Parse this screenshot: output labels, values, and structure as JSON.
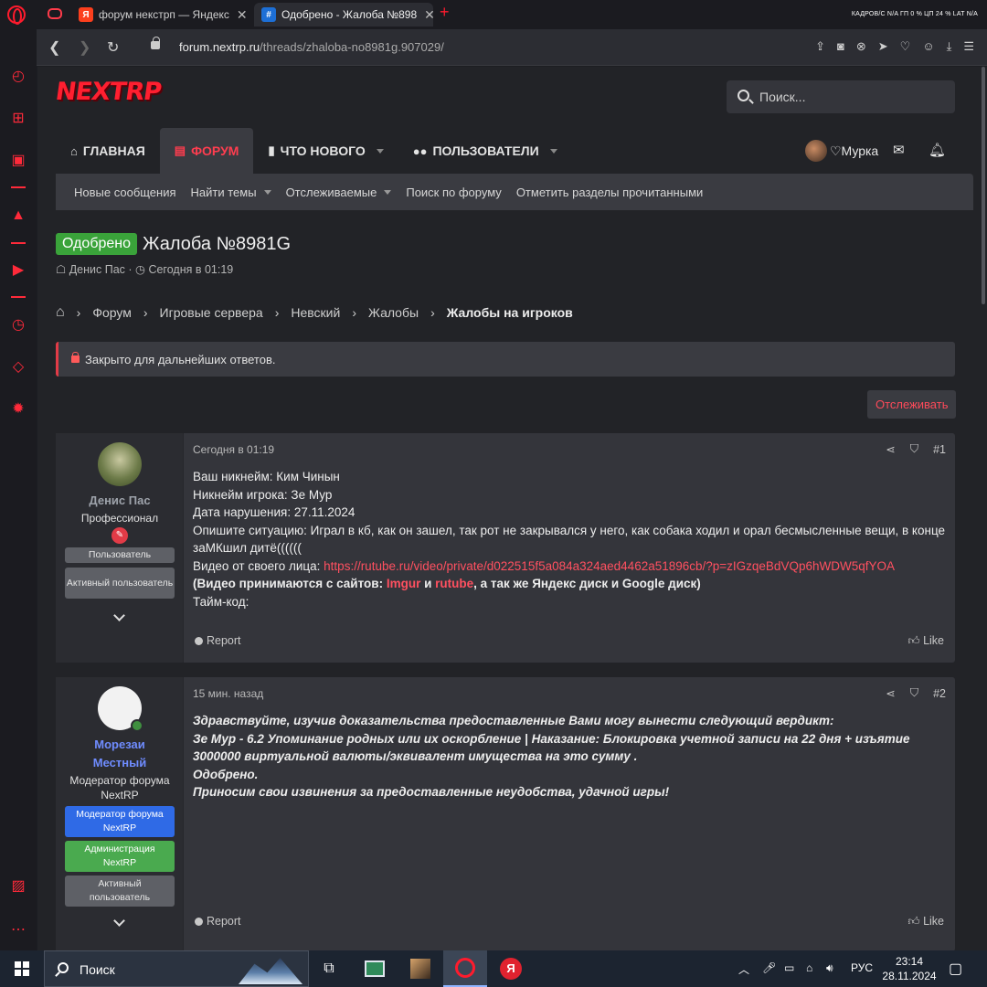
{
  "browser": {
    "tabs": [
      {
        "title": "форум некстрп — Яндекс",
        "favicon_color": "#fc3f1d",
        "favicon_letter": "Я"
      },
      {
        "title": "Одобрено - Жалоба №898",
        "favicon_color": "#1d6fd6",
        "favicon_letter": "#"
      }
    ],
    "sys_stats": "КАДРОВ/С N/A  ГП 0 %  ЦП 24 %  LAT N/A",
    "url_host": "forum.nextrp.ru",
    "url_path": "/threads/zhaloba-no8981g.907029/"
  },
  "site": {
    "logo": "NEXTRP",
    "search_placeholder": "Поиск...",
    "nav": [
      {
        "label": "Главная",
        "icon": "home-icon"
      },
      {
        "label": "Форум",
        "icon": "chat-icon",
        "active": true
      },
      {
        "label": "Что нового",
        "icon": "alert-icon"
      },
      {
        "label": "Пользователи",
        "icon": "users-icon"
      }
    ],
    "user_name": "♡Мурка",
    "subnav": [
      "Новые сообщения",
      "Найти темы",
      "Отслеживаемые",
      "Поиск по форуму",
      "Отметить разделы прочитанными"
    ]
  },
  "thread": {
    "status_badge": "Одобрено",
    "title": "Жалоба №8981G",
    "author": "Денис Пас",
    "date": "Сегодня в 01:19",
    "breadcrumbs": [
      "Форум",
      "Игровые сервера",
      "Невский",
      "Жалобы",
      "Жалобы на игроков"
    ],
    "closed_notice": "Закрыто для дальнейших ответов.",
    "watch_button": "Отслеживать"
  },
  "posts": [
    {
      "user": "Денис Пас",
      "user_title": "Профессионал",
      "badges": [
        "Пользователь",
        "Активный пользователь"
      ],
      "date": "Сегодня в 01:19",
      "number": "#1",
      "lines": {
        "l1": "Ваш никнейм: Ким Чинын",
        "l2": "Никнейм игрока: Зе Мур",
        "l3": "Дата нарушения: 27.11.2024",
        "l4": "Опишите ситуацию: Играл в кб, как он зашел, так рот не закрывался у него, как собака ходил и орал бесмысленные вещи, в конце заМКшил дитё((((((",
        "l5_label": "Видео от своего лица: ",
        "l5_link": "https://rutube.ru/video/private/d022515f5a084a324aed4462a51896cb/?p=zIGzqeBdVQp6hWDW5qfYOA",
        "l6_a": "(Видео принимаются с сайтов: ",
        "l6_b": "Imgur",
        "l6_c": " и ",
        "l6_d": "rutube",
        "l6_e": ", а так же Яндекс диск и Google диск)",
        "l7": "Тайм-код:"
      },
      "report": "Report",
      "like": "Like"
    },
    {
      "user_line1": "Морезаи",
      "user_line2": "Местный",
      "user_title": "Модератор форума NextRP",
      "badges": [
        "Модератор форума NextRP",
        "Администрация NextRP",
        "Активный пользователь"
      ],
      "date": "15 мин. назад",
      "number": "#2",
      "lines": {
        "l1": "Здравствуйте, изучив доказательства предоставленные Вами могу вынести следующий вердикт:",
        "l2": "Зе Мур - 6.2 Упоминание родных или их оскорбление | Наказание: Блокировка учетной записи на 22 дня + изъятие 3000000 виртуальной валюты/эквивалент имущества на это сумму .",
        "l3": "Одобрено.",
        "l4": "Приносим свои извинения за предоставленные неудобства, удачной игры!"
      },
      "report": "Report",
      "like": "Like"
    }
  ],
  "taskbar": {
    "search": "Поиск",
    "lang": "РУС",
    "time": "23:14",
    "date": "28.11.2024"
  },
  "colors": {
    "accent": "#ff3d4f",
    "approved": "#3aa33a"
  }
}
